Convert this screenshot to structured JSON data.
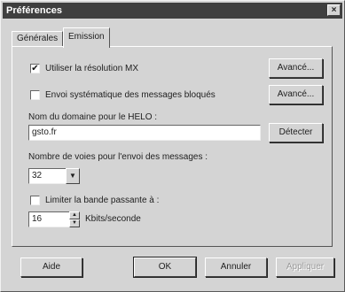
{
  "window": {
    "title": "Préférences",
    "close_glyph": "×"
  },
  "tabs": [
    {
      "label": "Générales",
      "active": false
    },
    {
      "label": "Emission",
      "active": true
    }
  ],
  "emission": {
    "mx": {
      "label": "Utiliser la résolution MX",
      "checked": true,
      "check_glyph": "✔"
    },
    "blocked": {
      "label": "Envoi systématique des messages bloqués",
      "checked": false
    },
    "advanced_btn_1": "Avancé...",
    "advanced_btn_2": "Avancé...",
    "helo_label": "Nom du domaine pour le HELO :",
    "helo_value": "gsto.fr",
    "detect_btn": "Détecter",
    "paths_label": "Nombre de voies pour l'envoi des messages :",
    "paths_value": "32",
    "bandwidth": {
      "label": "Limiter la bande passante à :",
      "checked": false
    },
    "bandwidth_value": "16",
    "bandwidth_unit": "Kbits/seconde"
  },
  "footer": {
    "help": "Aide",
    "ok": "OK",
    "cancel": "Annuler",
    "apply": "Appliquer"
  }
}
